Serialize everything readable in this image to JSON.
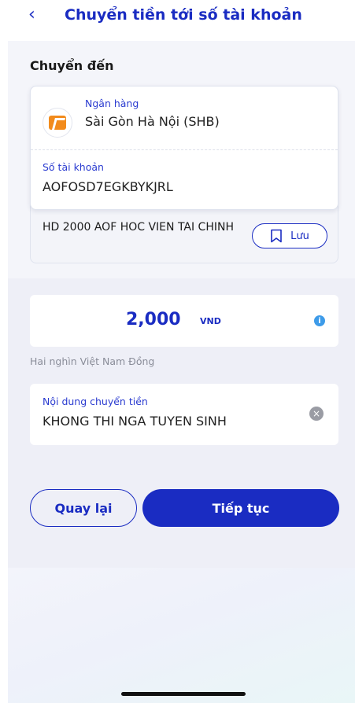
{
  "header": {
    "back_icon": "chevron-left-icon",
    "title": "Chuyển tiền tới số tài khoản"
  },
  "recipient": {
    "section_label": "Chuyển đến",
    "bank_label": "Ngân hàng",
    "bank_name": "Sài Gòn Hà Nội (SHB)",
    "account_label": "Số tài khoản",
    "account_number": "AOFOSD7EGKBYKJRL",
    "account_holder": "HD 2000 AOF HOC VIEN TAI CHINH",
    "save_label": "Lưu",
    "save_icon": "bookmark-icon"
  },
  "amount": {
    "value": "2,000",
    "currency": "VND",
    "info_icon": "i",
    "in_words": "Hai nghìn Việt Nam Đồng"
  },
  "transfer_content": {
    "label": "Nội dung chuyển tiền",
    "value": "KHONG THI NGA TUYEN SINH",
    "clear_icon": "×"
  },
  "actions": {
    "back_label": "Quay lại",
    "next_label": "Tiếp tục"
  },
  "colors": {
    "primary": "#1a2cc2",
    "info": "#3d9be9",
    "bank_logo": "#f28b1c"
  }
}
